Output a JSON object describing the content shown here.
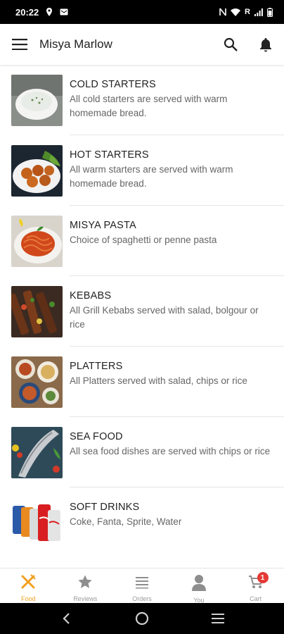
{
  "status_bar": {
    "time": "20:22",
    "network_label": "R"
  },
  "app_bar": {
    "title": "Misya Marlow"
  },
  "categories": [
    {
      "name": "COLD STARTERS",
      "description": "All cold starters are served with warm homemade bread."
    },
    {
      "name": "HOT STARTERS",
      "description": "All warm starters are served with warm homemade bread."
    },
    {
      "name": "MISYA PASTA",
      "description": "Choice of spaghetti or penne pasta"
    },
    {
      "name": "KEBABS",
      "description": "All Grill Kebabs served with salad, bolgour or rice"
    },
    {
      "name": "PLATTERS",
      "description": "All Platters served with salad, chips or rice"
    },
    {
      "name": "SEA FOOD",
      "description": "All sea food dishes are served with chips or rice"
    },
    {
      "name": "SOFT DRINKS",
      "description": "Coke, Fanta, Sprite, Water"
    }
  ],
  "bottom_nav": {
    "items": [
      {
        "label": "Food",
        "icon": "fork-knife-icon",
        "active": true
      },
      {
        "label": "Reviews",
        "icon": "star-icon"
      },
      {
        "label": "Orders",
        "icon": "list-icon"
      },
      {
        "label": "You",
        "icon": "person-icon"
      },
      {
        "label": "Cart",
        "icon": "cart-icon",
        "badge": "1"
      }
    ]
  },
  "colors": {
    "accent": "#f0a020",
    "badge": "#e53935"
  }
}
